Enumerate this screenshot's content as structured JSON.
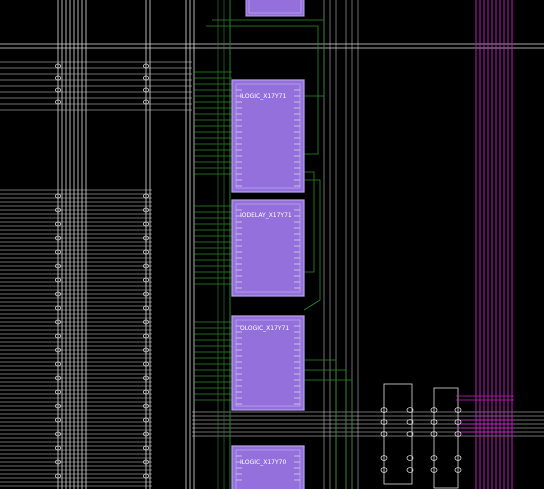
{
  "view": {
    "background": "#000000",
    "wire_color": "#dcdcdc",
    "net_color": "#2e8b2e",
    "bus_color": "#d020d0",
    "site_fill": "#9370db",
    "site_border": "#b9a3ee"
  },
  "sites": [
    {
      "name": ""
    },
    {
      "name": "ILOGIC_X17Y71"
    },
    {
      "name": "IODELAY_X17Y71"
    },
    {
      "name": "OLOGIC_X17Y71"
    },
    {
      "name": "ILOGIC_X17Y70"
    }
  ]
}
